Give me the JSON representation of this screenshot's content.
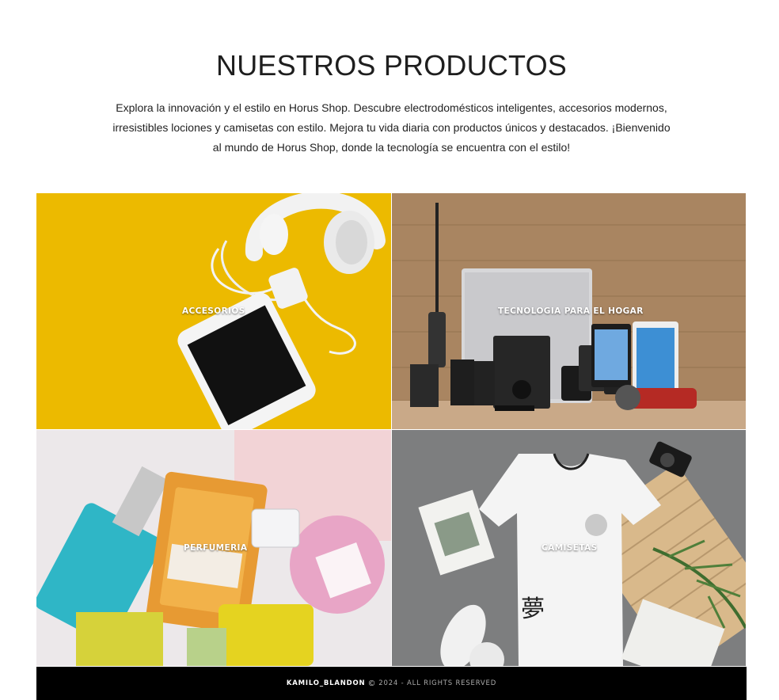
{
  "section": {
    "title": "NUESTROS PRODUCTOS",
    "intro": "Explora la innovación y el estilo en Horus Shop. Descubre electrodomésticos inteligentes, accesorios modernos, irresistibles lociones y camisetas con estilo. Mejora tu vida diaria con productos únicos y destacados. ¡Bienvenido al mundo de Horus Shop, donde la tecnología se encuentra con el estilo!"
  },
  "categories": [
    {
      "label": "ACCESORIOS",
      "image": "headphones-phone-charger-on-yellow"
    },
    {
      "label": "TECNOLOGIA PARA EL HOGAR",
      "image": "appliances-speakers-phones-on-wood"
    },
    {
      "label": "PERFUMERIA",
      "image": "perfume-bottles"
    },
    {
      "label": "CAMISETAS",
      "image": "white-tshirt-flatlay"
    }
  ],
  "footer": {
    "author": "KAMILO_BLANDON",
    "copyright_icon": "copyright-icon",
    "rights": "2024 - ALL RIGHTS RESERVED"
  },
  "colors": {
    "accessories_bg": "#e8b400",
    "wood_bg": "#a98561",
    "perfume_bg": "#e8e4e6",
    "tshirt_bg": "#7f8080",
    "footer_bg": "#000000"
  }
}
